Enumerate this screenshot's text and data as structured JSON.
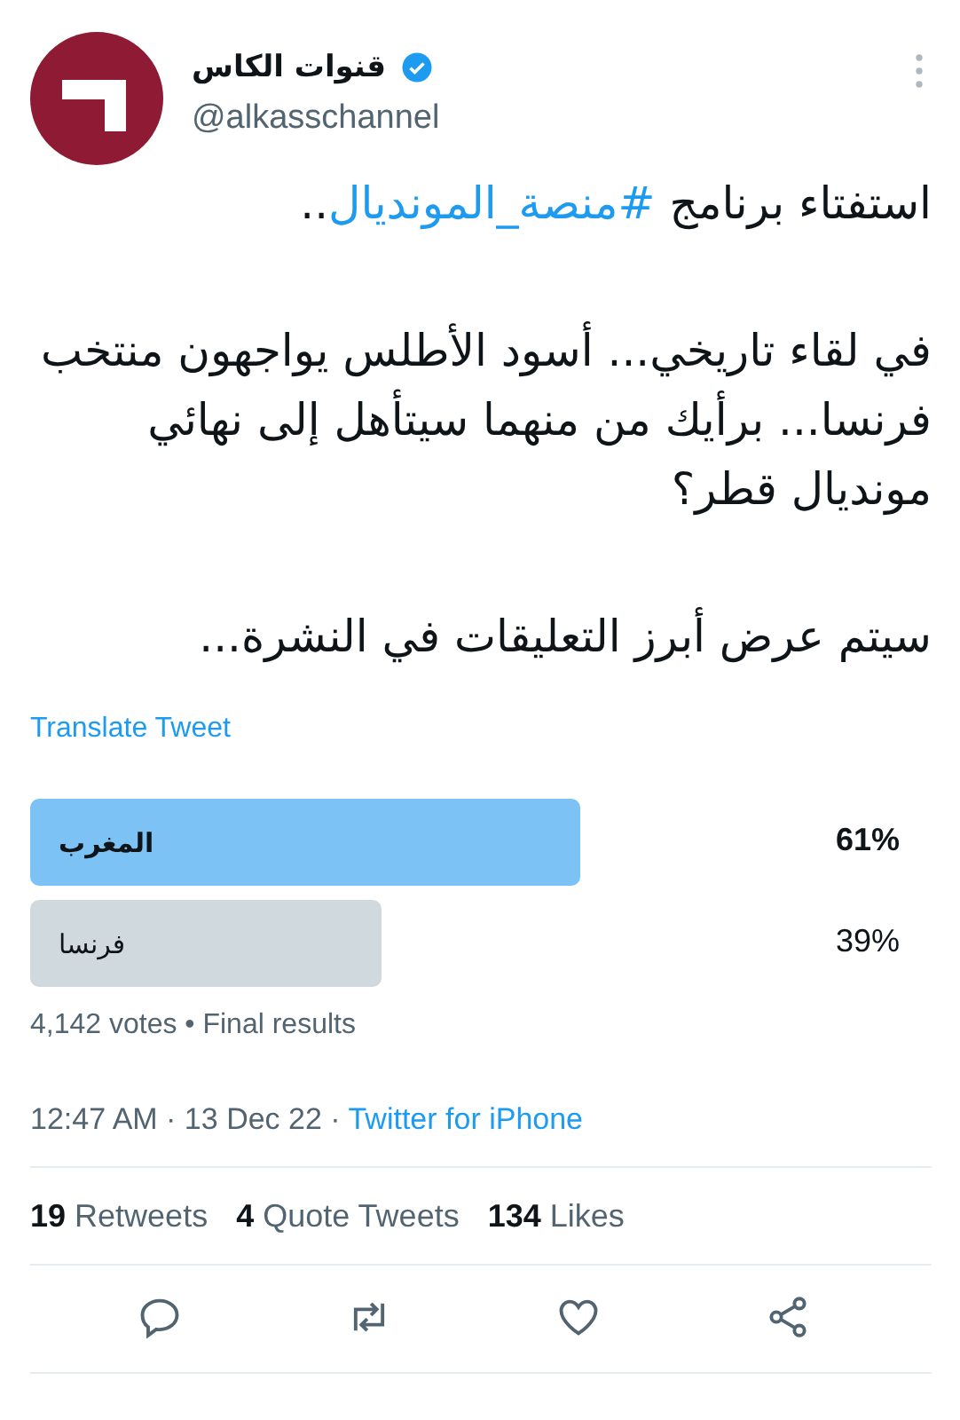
{
  "author": {
    "name": "قنوات الكاس",
    "verified": true,
    "handle": "@alkasschannel"
  },
  "paragraphs": [
    {
      "parts": [
        {
          "kind": "plain",
          "text": "استفتاء برنامج "
        },
        {
          "kind": "hashtag",
          "text": "#منصة_المونديال"
        },
        {
          "kind": "plain",
          "text": ".."
        }
      ]
    },
    {
      "parts": [
        {
          "kind": "plain",
          "text": "في لقاء تاريخي... أسود الأطلس يواجهون منتخب فرنسا... برأيك من منهما سيتأهل إلى نهائي مونديال قطر؟"
        }
      ]
    },
    {
      "parts": [
        {
          "kind": "plain",
          "text": "سيتم عرض أبرز التعليقات في النشرة..."
        }
      ]
    }
  ],
  "translate": "Translate Tweet",
  "poll": {
    "options": [
      {
        "label": "المغرب",
        "percent": "61%",
        "winner": true
      },
      {
        "label": "فرنسا",
        "percent": "39%",
        "winner": false
      }
    ],
    "summary": "4,142 votes • Final results"
  },
  "meta": {
    "time": "12:47 AM · 13 Dec 22 · ",
    "source": "Twitter for iPhone"
  },
  "stats": {
    "retweets": {
      "count": "19",
      "label": "Retweets"
    },
    "quote_tweets": {
      "count": "4",
      "label": "Quote Tweets"
    },
    "likes": {
      "count": "134",
      "label": "Likes"
    }
  },
  "actions": [
    {
      "kind": "reply"
    },
    {
      "kind": "retweet"
    },
    {
      "kind": "like"
    },
    {
      "kind": "share"
    }
  ]
}
